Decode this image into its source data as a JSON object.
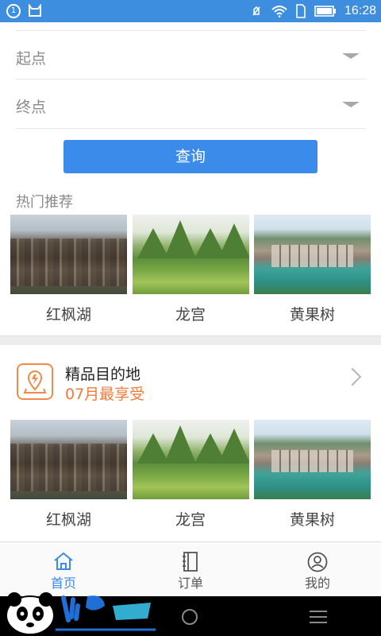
{
  "status_bar": {
    "time": "16:28",
    "left_badge": "1"
  },
  "form": {
    "start_label": "起点",
    "end_label": "终点",
    "query_button": "查询"
  },
  "hot": {
    "title": "热门推荐",
    "items": [
      {
        "name": "红枫湖",
        "image": "village-photo"
      },
      {
        "name": "龙宫",
        "image": "karst-landscape-photo"
      },
      {
        "name": "黄果树",
        "image": "river-town-photo"
      }
    ]
  },
  "selected": {
    "title": "精品目的地",
    "subtitle": "07月最享受",
    "accent_color": "#f07b3a",
    "items": [
      {
        "name": "红枫湖",
        "image": "village-photo"
      },
      {
        "name": "龙宫",
        "image": "karst-landscape-photo"
      },
      {
        "name": "黄果树",
        "image": "river-town-photo"
      }
    ]
  },
  "tabs": [
    {
      "label": "首页",
      "icon": "home-icon",
      "active": true
    },
    {
      "label": "订单",
      "icon": "notebook-icon",
      "active": false
    },
    {
      "label": "我的",
      "icon": "user-icon",
      "active": false
    }
  ],
  "theme": {
    "primary": "#3a8bea",
    "status_bar": "#3e8ee0"
  }
}
